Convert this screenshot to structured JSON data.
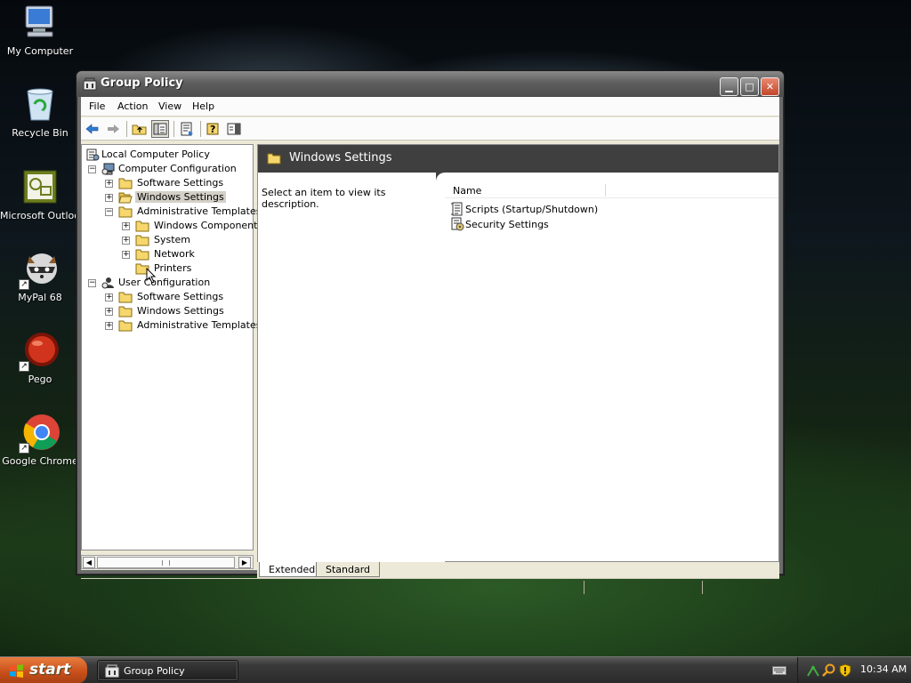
{
  "desktop_icons": [
    {
      "label": "My Computer",
      "icon": "my-computer-icon"
    },
    {
      "label": "Recycle Bin",
      "icon": "recycle-bin-icon"
    },
    {
      "label": "Microsoft Outloo",
      "icon": "outlook-icon"
    },
    {
      "label": "MyPal 68",
      "icon": "mypal-icon"
    },
    {
      "label": "Pego",
      "icon": "pego-icon"
    },
    {
      "label": "Google Chrome",
      "icon": "chrome-icon"
    }
  ],
  "window": {
    "title": "Group Policy",
    "menu": [
      "File",
      "Action",
      "View",
      "Help"
    ]
  },
  "tree": [
    {
      "label": "Local Computer Policy",
      "expander": ""
    },
    {
      "label": "Computer Configuration",
      "expander": "−"
    },
    {
      "label": "Software Settings",
      "expander": "+"
    },
    {
      "label": "Windows Settings",
      "expander": "+",
      "selected": true
    },
    {
      "label": "Administrative Templates",
      "expander": "−"
    },
    {
      "label": "Windows Components",
      "expander": "+"
    },
    {
      "label": "System",
      "expander": "+"
    },
    {
      "label": "Network",
      "expander": "+"
    },
    {
      "label": "Printers",
      "expander": ""
    },
    {
      "label": "User Configuration",
      "expander": "−"
    },
    {
      "label": "Software Settings",
      "expander": "+"
    },
    {
      "label": "Windows Settings",
      "expander": "+"
    },
    {
      "label": "Administrative Templates",
      "expander": "+"
    }
  ],
  "right_pane": {
    "header_title": "Windows Settings",
    "description": "Select an item to view its description.",
    "column_name": "Name",
    "items": [
      {
        "label": "Scripts (Startup/Shutdown)",
        "icon": "script-icon"
      },
      {
        "label": "Security Settings",
        "icon": "security-settings-icon"
      }
    ]
  },
  "tabs": [
    "Extended",
    "Standard"
  ],
  "taskbar": {
    "start_label": "start",
    "task_label": "Group Policy",
    "clock": "10:34 AM"
  },
  "colors": {
    "titlebar": "#5e5e5e",
    "pane_header": "#3f3f3f",
    "start_button": "#c9501a",
    "folder": "#f5d76e"
  }
}
